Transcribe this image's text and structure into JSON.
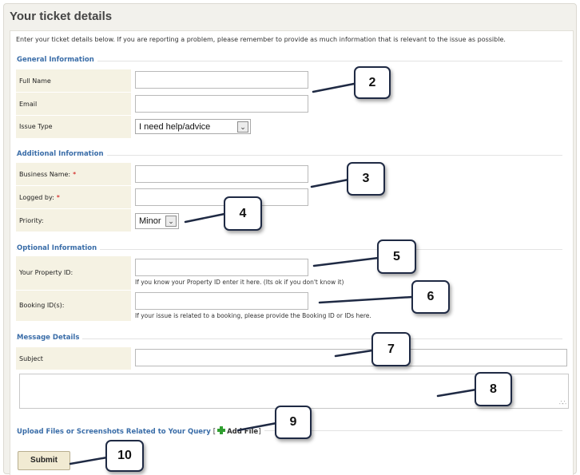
{
  "panel": {
    "title": "Your ticket details",
    "intro": "Enter your ticket details below. If you are reporting a problem, please remember to provide as much information that is relevant to the issue as possible."
  },
  "general": {
    "title": "General Information",
    "full_name_label": "Full Name",
    "full_name_value": "",
    "email_label": "Email",
    "email_value": "",
    "issue_type_label": "Issue Type",
    "issue_type_value": "I need help/advice"
  },
  "additional": {
    "title": "Additional Information",
    "business_name_label": "Business Name:",
    "business_name_value": "",
    "logged_by_label": "Logged by:",
    "logged_by_value": "",
    "required_marker": "*",
    "priority_label": "Priority:",
    "priority_value": "Minor"
  },
  "optional": {
    "title": "Optional Information",
    "property_id_label": "Your Property ID:",
    "property_id_value": "",
    "property_id_hint": "If you know your Property ID enter it here. (Its ok if you don't know it)",
    "booking_ids_label": "Booking ID(s):",
    "booking_ids_value": "",
    "booking_ids_hint": "If your issue is related to a booking, please provide the Booking ID or IDs here."
  },
  "message": {
    "title": "Message Details",
    "subject_label": "Subject",
    "subject_value": "",
    "body_value": ""
  },
  "upload": {
    "title": "Upload Files or Screenshots Related to Your Query",
    "bracket_open": "[",
    "add_file_label": "Add File",
    "bracket_close": "]"
  },
  "submit_label": "Submit",
  "callouts": [
    "2",
    "3",
    "4",
    "5",
    "6",
    "7",
    "8",
    "9",
    "10"
  ],
  "colors": {
    "section_title": "#3a6da8",
    "label_bg": "#f5f2e3",
    "required": "#cc0000",
    "add_icon": "#2f9e2f",
    "callout_border": "#1f2a44"
  },
  "icons": {
    "add_file": "plus-icon",
    "dropdown": "chevron-down-icon",
    "resize": "resize-grip-icon"
  }
}
